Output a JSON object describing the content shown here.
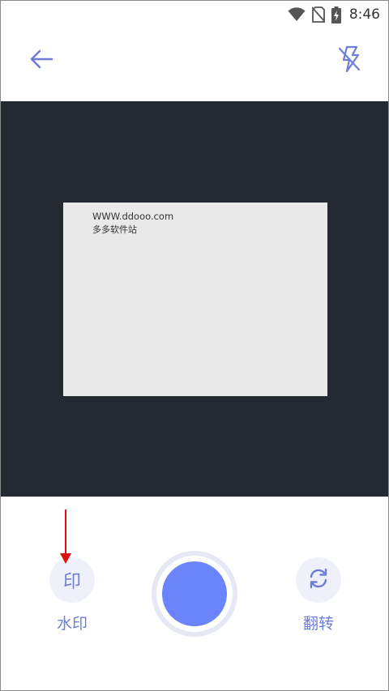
{
  "status_bar": {
    "time": "8:46",
    "icons": [
      "wifi-icon",
      "no-sim-icon",
      "battery-charging-icon"
    ]
  },
  "top_bar": {
    "back_icon": "arrow-left-icon",
    "flash_icon": "flash-off-icon"
  },
  "preview": {
    "document_lines": [
      "WWW.ddooo.com",
      "多多软件站"
    ]
  },
  "controls": {
    "watermark_glyph": "印",
    "watermark_label": "水印",
    "flip_icon": "rotate-icon",
    "flip_label": "翻转",
    "shutter_icon": "shutter-button"
  },
  "colors": {
    "accent": "#6e7ed8",
    "shutter": "#6c84fb",
    "preview_bg": "#252a32",
    "annotation": "#e01010"
  }
}
